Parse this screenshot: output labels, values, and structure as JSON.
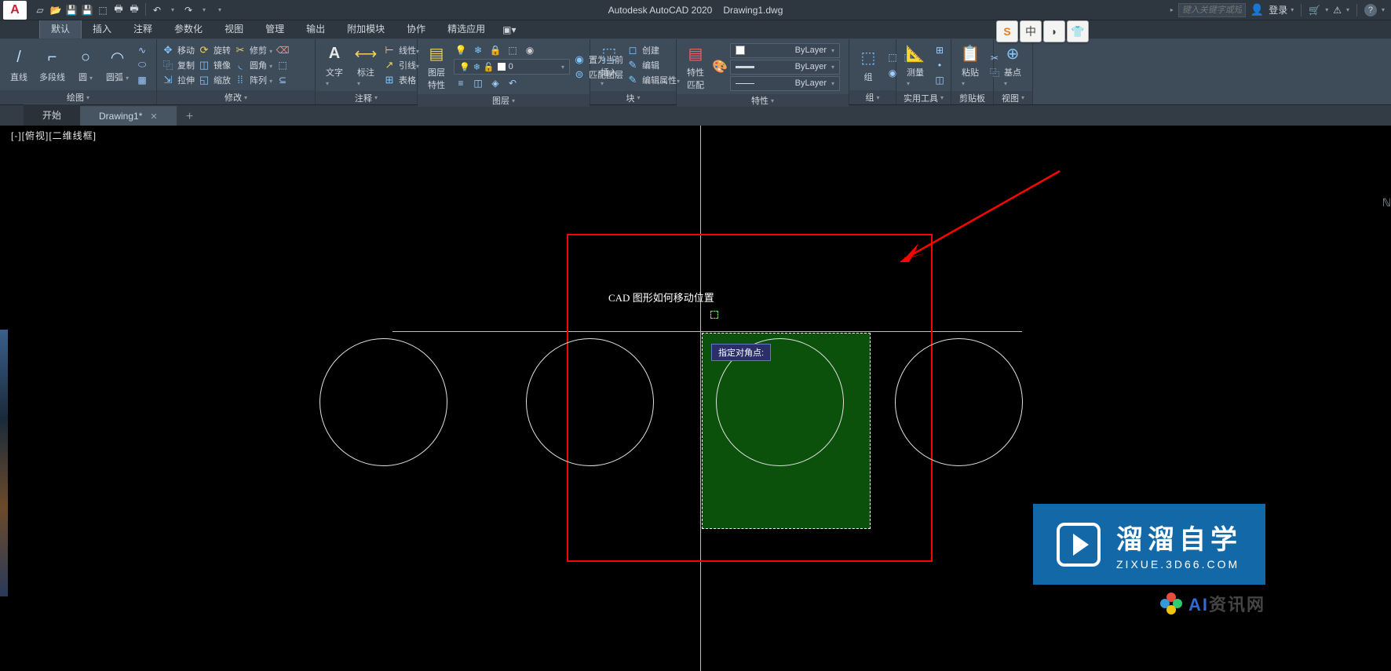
{
  "title": {
    "app": "Autodesk AutoCAD 2020",
    "file": "Drawing1.dwg"
  },
  "search_placeholder": "键入关键字或短语",
  "login": "登录",
  "menu": {
    "active": "默认",
    "items": [
      "默认",
      "插入",
      "注释",
      "参数化",
      "视图",
      "管理",
      "输出",
      "附加模块",
      "协作",
      "精选应用"
    ]
  },
  "ribbon": {
    "draw": {
      "title": "绘图",
      "line": "直线",
      "polyline": "多段线",
      "circle": "圆",
      "arc": "圆弧"
    },
    "modify": {
      "title": "修改",
      "move": "移动",
      "rotate": "旋转",
      "trim": "修剪",
      "copy": "复制",
      "mirror": "镜像",
      "fillet": "圆角",
      "stretch": "拉伸",
      "scale": "缩放",
      "array": "阵列"
    },
    "annot": {
      "title": "注释",
      "text": "文字",
      "dim": "标注",
      "leader": "引线",
      "table": "表格",
      "linear": "线性"
    },
    "layers": {
      "title": "图层",
      "props": "图层\n特性",
      "current": "0",
      "setcurrent": "置为当前",
      "match": "匹配图层"
    },
    "block": {
      "title": "块",
      "insert": "插入",
      "create": "创建",
      "edit": "编辑",
      "attr": "编辑属性"
    },
    "props": {
      "title": "特性",
      "match": "特性\n匹配",
      "bylayer": "ByLayer"
    },
    "group": {
      "title": "组",
      "label": "组"
    },
    "util": {
      "title": "实用工具",
      "measure": "测量"
    },
    "clip": {
      "title": "剪贴板",
      "paste": "粘贴"
    },
    "view": {
      "title": "视图",
      "base": "基点"
    }
  },
  "filetabs": {
    "start": "开始",
    "active": "Drawing1*"
  },
  "viewport": {
    "label": "[-][俯视][二维线框]",
    "text": "CAD 图形如何移动位置",
    "tooltip": "指定对角点:"
  },
  "wm1": {
    "t1": "溜溜自学",
    "t2": "ZIXUE.3D66.COM"
  },
  "wm2": {
    "a": "AI",
    "b": "资讯网"
  },
  "ime": [
    "S",
    "中",
    "◗",
    "👕"
  ]
}
